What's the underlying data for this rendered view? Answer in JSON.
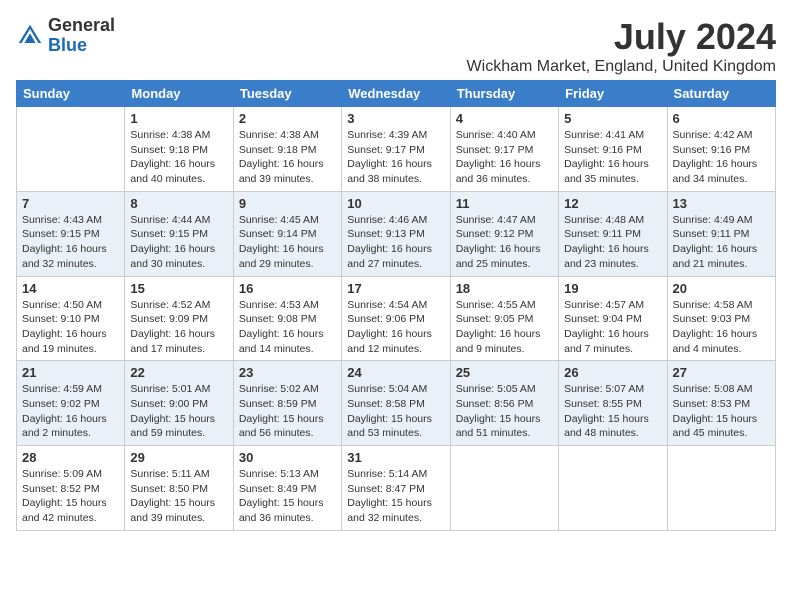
{
  "logo": {
    "general": "General",
    "blue": "Blue"
  },
  "title": "July 2024",
  "location": "Wickham Market, England, United Kingdom",
  "days_of_week": [
    "Sunday",
    "Monday",
    "Tuesday",
    "Wednesday",
    "Thursday",
    "Friday",
    "Saturday"
  ],
  "weeks": [
    [
      {
        "day": "",
        "info": ""
      },
      {
        "day": "1",
        "info": "Sunrise: 4:38 AM\nSunset: 9:18 PM\nDaylight: 16 hours\nand 40 minutes."
      },
      {
        "day": "2",
        "info": "Sunrise: 4:38 AM\nSunset: 9:18 PM\nDaylight: 16 hours\nand 39 minutes."
      },
      {
        "day": "3",
        "info": "Sunrise: 4:39 AM\nSunset: 9:17 PM\nDaylight: 16 hours\nand 38 minutes."
      },
      {
        "day": "4",
        "info": "Sunrise: 4:40 AM\nSunset: 9:17 PM\nDaylight: 16 hours\nand 36 minutes."
      },
      {
        "day": "5",
        "info": "Sunrise: 4:41 AM\nSunset: 9:16 PM\nDaylight: 16 hours\nand 35 minutes."
      },
      {
        "day": "6",
        "info": "Sunrise: 4:42 AM\nSunset: 9:16 PM\nDaylight: 16 hours\nand 34 minutes."
      }
    ],
    [
      {
        "day": "7",
        "info": "Sunrise: 4:43 AM\nSunset: 9:15 PM\nDaylight: 16 hours\nand 32 minutes."
      },
      {
        "day": "8",
        "info": "Sunrise: 4:44 AM\nSunset: 9:15 PM\nDaylight: 16 hours\nand 30 minutes."
      },
      {
        "day": "9",
        "info": "Sunrise: 4:45 AM\nSunset: 9:14 PM\nDaylight: 16 hours\nand 29 minutes."
      },
      {
        "day": "10",
        "info": "Sunrise: 4:46 AM\nSunset: 9:13 PM\nDaylight: 16 hours\nand 27 minutes."
      },
      {
        "day": "11",
        "info": "Sunrise: 4:47 AM\nSunset: 9:12 PM\nDaylight: 16 hours\nand 25 minutes."
      },
      {
        "day": "12",
        "info": "Sunrise: 4:48 AM\nSunset: 9:11 PM\nDaylight: 16 hours\nand 23 minutes."
      },
      {
        "day": "13",
        "info": "Sunrise: 4:49 AM\nSunset: 9:11 PM\nDaylight: 16 hours\nand 21 minutes."
      }
    ],
    [
      {
        "day": "14",
        "info": "Sunrise: 4:50 AM\nSunset: 9:10 PM\nDaylight: 16 hours\nand 19 minutes."
      },
      {
        "day": "15",
        "info": "Sunrise: 4:52 AM\nSunset: 9:09 PM\nDaylight: 16 hours\nand 17 minutes."
      },
      {
        "day": "16",
        "info": "Sunrise: 4:53 AM\nSunset: 9:08 PM\nDaylight: 16 hours\nand 14 minutes."
      },
      {
        "day": "17",
        "info": "Sunrise: 4:54 AM\nSunset: 9:06 PM\nDaylight: 16 hours\nand 12 minutes."
      },
      {
        "day": "18",
        "info": "Sunrise: 4:55 AM\nSunset: 9:05 PM\nDaylight: 16 hours\nand 9 minutes."
      },
      {
        "day": "19",
        "info": "Sunrise: 4:57 AM\nSunset: 9:04 PM\nDaylight: 16 hours\nand 7 minutes."
      },
      {
        "day": "20",
        "info": "Sunrise: 4:58 AM\nSunset: 9:03 PM\nDaylight: 16 hours\nand 4 minutes."
      }
    ],
    [
      {
        "day": "21",
        "info": "Sunrise: 4:59 AM\nSunset: 9:02 PM\nDaylight: 16 hours\nand 2 minutes."
      },
      {
        "day": "22",
        "info": "Sunrise: 5:01 AM\nSunset: 9:00 PM\nDaylight: 15 hours\nand 59 minutes."
      },
      {
        "day": "23",
        "info": "Sunrise: 5:02 AM\nSunset: 8:59 PM\nDaylight: 15 hours\nand 56 minutes."
      },
      {
        "day": "24",
        "info": "Sunrise: 5:04 AM\nSunset: 8:58 PM\nDaylight: 15 hours\nand 53 minutes."
      },
      {
        "day": "25",
        "info": "Sunrise: 5:05 AM\nSunset: 8:56 PM\nDaylight: 15 hours\nand 51 minutes."
      },
      {
        "day": "26",
        "info": "Sunrise: 5:07 AM\nSunset: 8:55 PM\nDaylight: 15 hours\nand 48 minutes."
      },
      {
        "day": "27",
        "info": "Sunrise: 5:08 AM\nSunset: 8:53 PM\nDaylight: 15 hours\nand 45 minutes."
      }
    ],
    [
      {
        "day": "28",
        "info": "Sunrise: 5:09 AM\nSunset: 8:52 PM\nDaylight: 15 hours\nand 42 minutes."
      },
      {
        "day": "29",
        "info": "Sunrise: 5:11 AM\nSunset: 8:50 PM\nDaylight: 15 hours\nand 39 minutes."
      },
      {
        "day": "30",
        "info": "Sunrise: 5:13 AM\nSunset: 8:49 PM\nDaylight: 15 hours\nand 36 minutes."
      },
      {
        "day": "31",
        "info": "Sunrise: 5:14 AM\nSunset: 8:47 PM\nDaylight: 15 hours\nand 32 minutes."
      },
      {
        "day": "",
        "info": ""
      },
      {
        "day": "",
        "info": ""
      },
      {
        "day": "",
        "info": ""
      }
    ]
  ]
}
